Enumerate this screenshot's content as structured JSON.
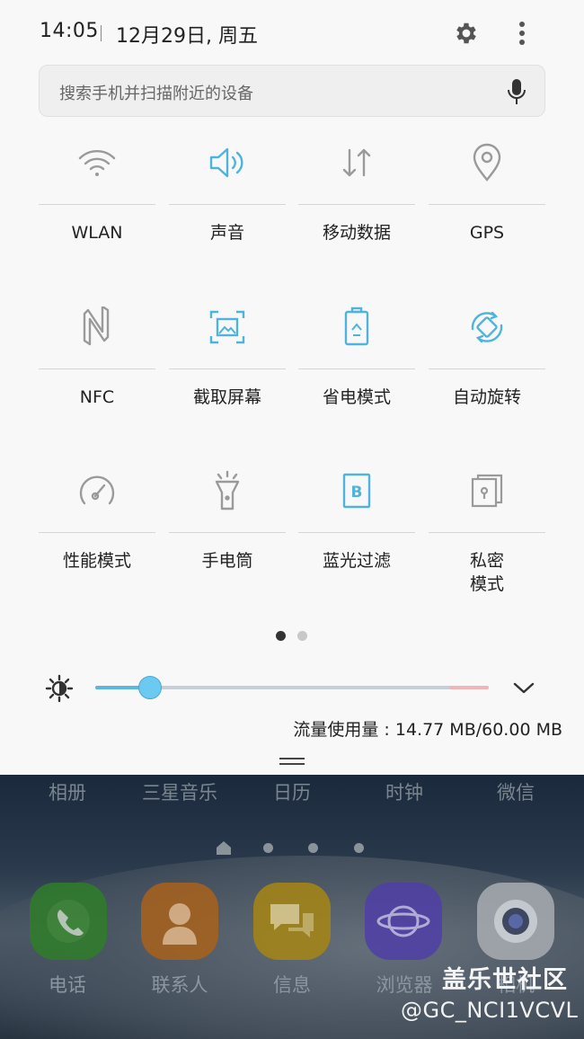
{
  "status": {
    "time": "14:05",
    "date": "12月29日, 周五",
    "settings_icon": "gear-icon",
    "more_icon": "more-vertical-icon"
  },
  "search": {
    "placeholder": "搜索手机并扫描附近的设备",
    "mic_icon": "mic-icon"
  },
  "tiles": [
    {
      "label": "WLAN",
      "icon": "wifi-icon",
      "active": false
    },
    {
      "label": "声音",
      "icon": "speaker-icon",
      "active": true
    },
    {
      "label": "移动数据",
      "icon": "mobile-data-icon",
      "active": false
    },
    {
      "label": "GPS",
      "icon": "location-pin-icon",
      "active": false
    },
    {
      "label": "NFC",
      "icon": "nfc-icon",
      "active": false
    },
    {
      "label": "截取屏幕",
      "icon": "screenshot-icon",
      "active": true
    },
    {
      "label": "省电模式",
      "icon": "battery-saver-icon",
      "active": true
    },
    {
      "label": "自动旋转",
      "icon": "auto-rotate-icon",
      "active": true
    },
    {
      "label": "性能模式",
      "icon": "speedometer-icon",
      "active": false
    },
    {
      "label": "手电筒",
      "icon": "flashlight-icon",
      "active": false
    },
    {
      "label": "蓝光过滤",
      "icon": "blue-light-filter-icon",
      "active": true
    },
    {
      "label": "私密\n模式",
      "icon": "private-mode-icon",
      "active": false
    }
  ],
  "pager": {
    "pages": 2,
    "current": 1
  },
  "brightness": {
    "level": 0.14,
    "icon": "brightness-icon",
    "expand_icon": "chevron-down-icon"
  },
  "data_usage": "流量使用量 : 14.77 MB/60.00 MB",
  "home": {
    "app_row_labels": [
      "相册",
      "三星音乐",
      "日历",
      "时钟",
      "微信"
    ],
    "page_indicator": {
      "pages": 4,
      "current": 0
    },
    "dock": [
      {
        "label": "电话",
        "icon": "phone-icon",
        "color": "#3a9a2e"
      },
      {
        "label": "联系人",
        "icon": "contacts-icon",
        "color": "#d8741a"
      },
      {
        "label": "信息",
        "icon": "messages-icon",
        "color": "#d6a91a"
      },
      {
        "label": "浏览器",
        "icon": "browser-icon",
        "color": "#5a4ac8"
      },
      {
        "label": "相机",
        "icon": "camera-icon",
        "color": "#c8cdd4"
      }
    ]
  },
  "watermark": {
    "site": "盖乐世社区",
    "user": "@GC_NCI1VCVL"
  },
  "colors": {
    "accent": "#4fb3dc",
    "inactive_icon": "#9a9a9a",
    "panel_bg": "#f8f8f8"
  }
}
